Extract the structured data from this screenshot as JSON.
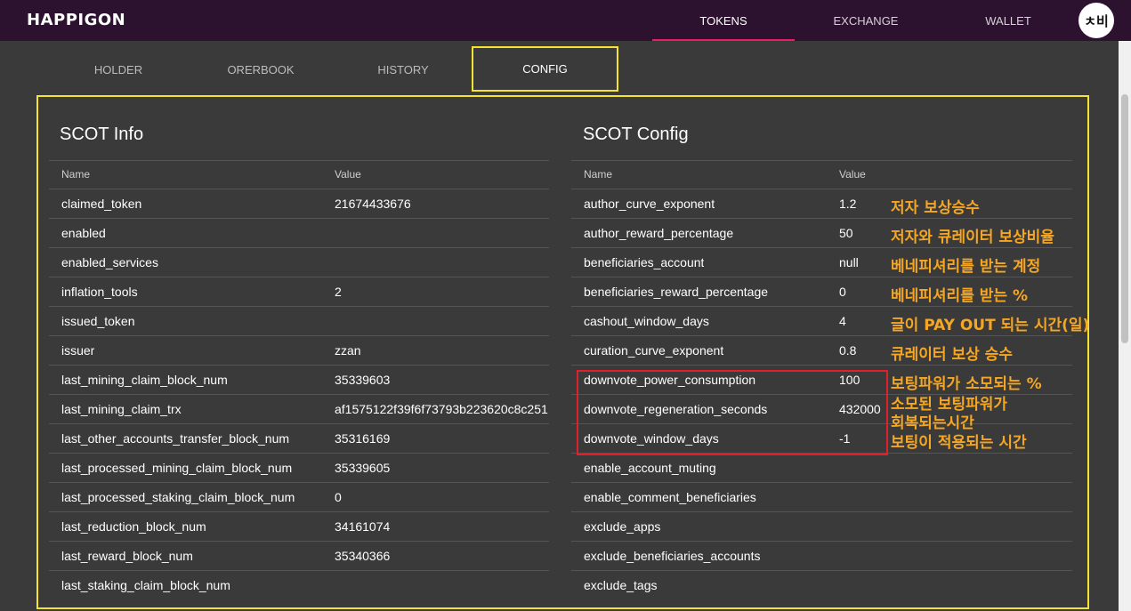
{
  "app": {
    "logo": "HAPPIGON",
    "avatar_text": "ㅊ비"
  },
  "nav": [
    {
      "label": "TOKENS",
      "active": true
    },
    {
      "label": "EXCHANGE",
      "active": false
    },
    {
      "label": "WALLET",
      "active": false
    }
  ],
  "tabs": [
    {
      "label": "HOLDER"
    },
    {
      "label": "ORERBOOK"
    },
    {
      "label": "HISTORY"
    },
    {
      "label": "CONFIG"
    }
  ],
  "info": {
    "title": "SCOT Info",
    "col_name": "Name",
    "col_value": "Value",
    "rows": [
      {
        "name": "claimed_token",
        "value": "21674433676"
      },
      {
        "name": "enabled",
        "value": ""
      },
      {
        "name": "enabled_services",
        "value": ""
      },
      {
        "name": "inflation_tools",
        "value": "2"
      },
      {
        "name": "issued_token",
        "value": ""
      },
      {
        "name": "issuer",
        "value": "zzan"
      },
      {
        "name": "last_mining_claim_block_num",
        "value": "35339603"
      },
      {
        "name": "last_mining_claim_trx",
        "value": "af1575122f39f6f73793b223620c8c251"
      },
      {
        "name": "last_other_accounts_transfer_block_num",
        "value": "35316169"
      },
      {
        "name": "last_processed_mining_claim_block_num",
        "value": "35339605"
      },
      {
        "name": "last_processed_staking_claim_block_num",
        "value": "0"
      },
      {
        "name": "last_reduction_block_num",
        "value": "34161074"
      },
      {
        "name": "last_reward_block_num",
        "value": "35340366"
      },
      {
        "name": "last_staking_claim_block_num",
        "value": ""
      }
    ]
  },
  "config": {
    "title": "SCOT Config",
    "col_name": "Name",
    "col_value": "Value",
    "rows": [
      {
        "name": "author_curve_exponent",
        "value": "1.2"
      },
      {
        "name": "author_reward_percentage",
        "value": "50"
      },
      {
        "name": "beneficiaries_account",
        "value": "null"
      },
      {
        "name": "beneficiaries_reward_percentage",
        "value": "0"
      },
      {
        "name": "cashout_window_days",
        "value": "4"
      },
      {
        "name": "curation_curve_exponent",
        "value": "0.8"
      },
      {
        "name": "downvote_power_consumption",
        "value": "100"
      },
      {
        "name": "downvote_regeneration_seconds",
        "value": "432000"
      },
      {
        "name": "downvote_window_days",
        "value": "-1"
      },
      {
        "name": "enable_account_muting",
        "value": ""
      },
      {
        "name": "enable_comment_beneficiaries",
        "value": ""
      },
      {
        "name": "exclude_apps",
        "value": ""
      },
      {
        "name": "exclude_beneficiaries_accounts",
        "value": ""
      },
      {
        "name": "exclude_tags",
        "value": ""
      }
    ]
  },
  "annotations": [
    "저자 보상승수",
    "저자와 큐레이터 보상비율",
    "베네피셔리를 받는 계정",
    "베네피셔리를 받는 %",
    "글이 PAY OUT 되는 시간(일)",
    "큐레이터 보상 승수",
    "보팅파워가 소모되는 %",
    "소모된 보팅파워가",
    "회복되는시간",
    "보팅이 적용되는 시간"
  ],
  "colors": {
    "highlight": "#f5e330",
    "annotation": "#f5a623",
    "red_box": "#e0202a",
    "topbar": "#2d1230",
    "nav_underline": "#e91e63"
  }
}
